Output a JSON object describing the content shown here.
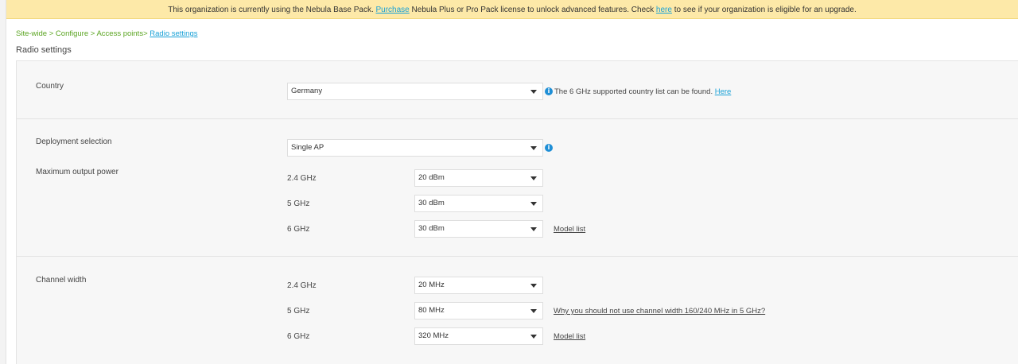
{
  "banner": {
    "text_before": "This organization is currently using the Nebula Base Pack.",
    "purchase_link": "Purchase",
    "text_middle": "Nebula Plus or Pro Pack license to unlock advanced features. Check",
    "here_link": "here",
    "text_after": "to see if your organization is eligible for an upgrade."
  },
  "breadcrumb": {
    "items": [
      "Site-wide",
      "Configure",
      "Access points"
    ],
    "separator": ">",
    "current": "Radio settings"
  },
  "page_title": "Radio settings",
  "country": {
    "label": "Country",
    "value": "Germany",
    "note": "The 6 GHz supported country list can be found.",
    "note_link": "Here"
  },
  "deployment": {
    "label": "Deployment selection",
    "value": "Single AP"
  },
  "max_output_power": {
    "label": "Maximum output power",
    "rows": [
      {
        "band": "2.4 GHz",
        "value": "20 dBm"
      },
      {
        "band": "5 GHz",
        "value": "30 dBm"
      },
      {
        "band": "6 GHz",
        "value": "30 dBm",
        "link": "Model list"
      }
    ]
  },
  "channel_width": {
    "label": "Channel width",
    "rows": [
      {
        "band": "2.4 GHz",
        "value": "20 MHz"
      },
      {
        "band": "5 GHz",
        "value": "80 MHz",
        "link": "Why you should not use channel width 160/240 MHz in 5 GHz?"
      },
      {
        "band": "6 GHz",
        "value": "320 MHz",
        "link": "Model list"
      }
    ]
  },
  "colors": {
    "banner_bg": "#fde9a8",
    "link": "#1aa1d6",
    "breadcrumb": "#5aa421",
    "info_icon": "#1f8fd6"
  },
  "icons": {
    "info": "info-circle-icon",
    "dropdown": "caret-down-icon"
  }
}
